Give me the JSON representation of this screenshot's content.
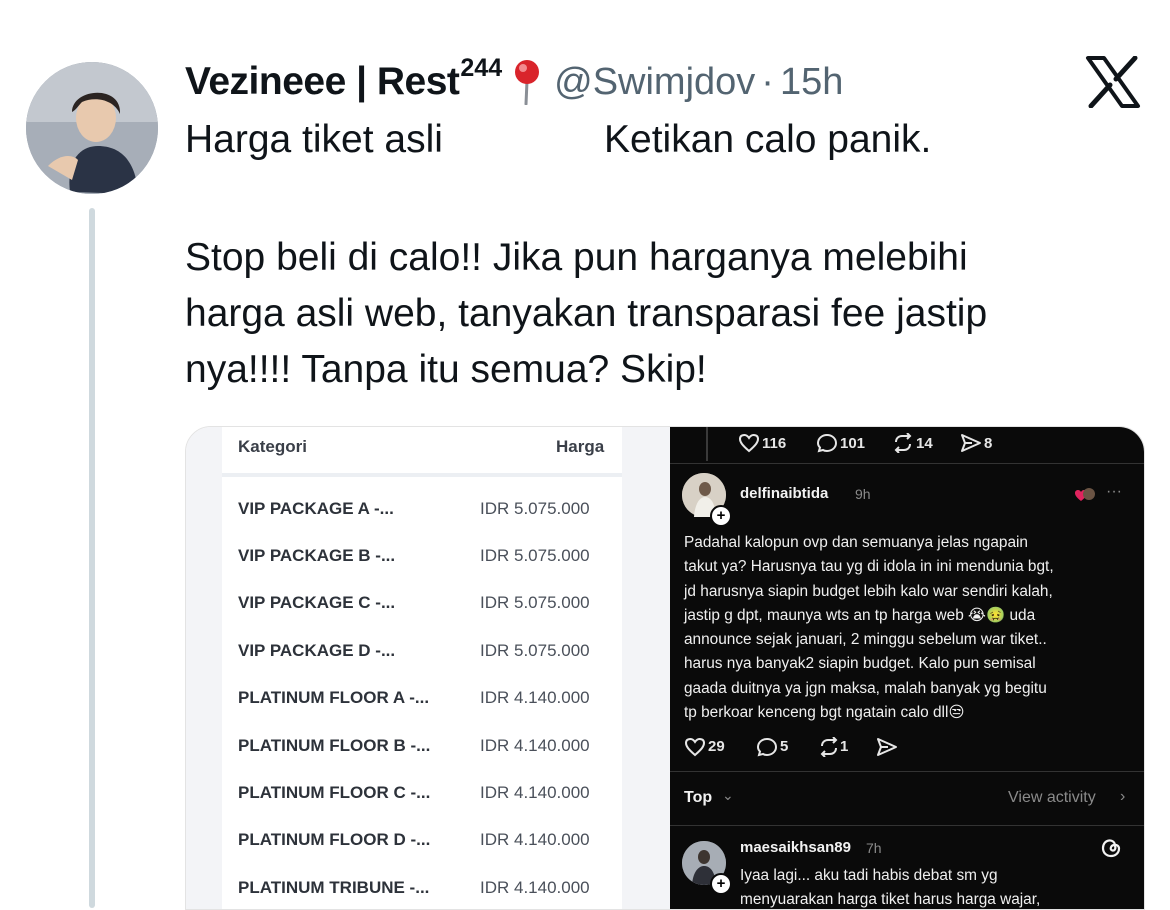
{
  "tweet": {
    "display_name": "Vezineee | Rest",
    "name_superscript": "244",
    "pin_icon": "round-pushpin-icon",
    "handle": "@Swimjdov",
    "separator": "·",
    "time": "15h",
    "platform_logo": "x-logo-icon",
    "line1_left": "Harga tiket asli",
    "line1_right": "Ketikan calo panik.",
    "body": "Stop beli di calo!! Jika pun harganya melebihi\nharga asli web, tanyakan transparasi fee jastip\nnya!!!! Tanpa itu semua? Skip!"
  },
  "price_table": {
    "col_category": "Kategori",
    "col_price": "Harga",
    "rows": [
      {
        "name": "VIP PACKAGE A -...",
        "price": "IDR 5.075.000"
      },
      {
        "name": "VIP PACKAGE B -...",
        "price": "IDR 5.075.000"
      },
      {
        "name": "VIP PACKAGE C -...",
        "price": "IDR 5.075.000"
      },
      {
        "name": "VIP PACKAGE D -...",
        "price": "IDR 5.075.000"
      },
      {
        "name": "PLATINUM FLOOR A -...",
        "price": "IDR 4.140.000"
      },
      {
        "name": "PLATINUM FLOOR B -...",
        "price": "IDR 4.140.000"
      },
      {
        "name": "PLATINUM FLOOR C -...",
        "price": "IDR 4.140.000"
      },
      {
        "name": "PLATINUM FLOOR D -...",
        "price": "IDR 4.140.000"
      },
      {
        "name": "PLATINUM TRIBUNE -...",
        "price": "IDR 4.140.000"
      }
    ]
  },
  "threads": {
    "top_stats": {
      "likes": "116",
      "replies": "101",
      "reposts": "14",
      "shares": "8"
    },
    "comment": {
      "username": "delfinaibtida",
      "time": "9h",
      "more": "···",
      "text": "Padahal kalopun ovp dan semuanya jelas ngapain\ntakut ya? Harusnya tau yg di idola in ini mendunia bgt,\njd harusnya siapin budget lebih kalo war sendiri kalah,\njastip g dpt, maunya wts an tp harga web 😭🤢 uda\nannounce sejak januari, 2 minggu sebelum war tiket..\nharus nya banyak2 siapin budget. Kalo pun semisal\ngaada duitnya ya jgn maksa, malah banyak yg begitu\ntp berkoar kenceng bgt ngatain calo dll😒",
      "stats": {
        "likes": "29",
        "replies": "5",
        "reposts": "1"
      }
    },
    "sort_label": "Top",
    "view_activity": "View activity",
    "next_comment": {
      "username": "maesaikhsan89",
      "time": "7h",
      "line1": "Iyaa lagi... aku tadi habis debat sm yg",
      "line2": "menyuarakan harga tiket harus harga wajar,"
    }
  }
}
